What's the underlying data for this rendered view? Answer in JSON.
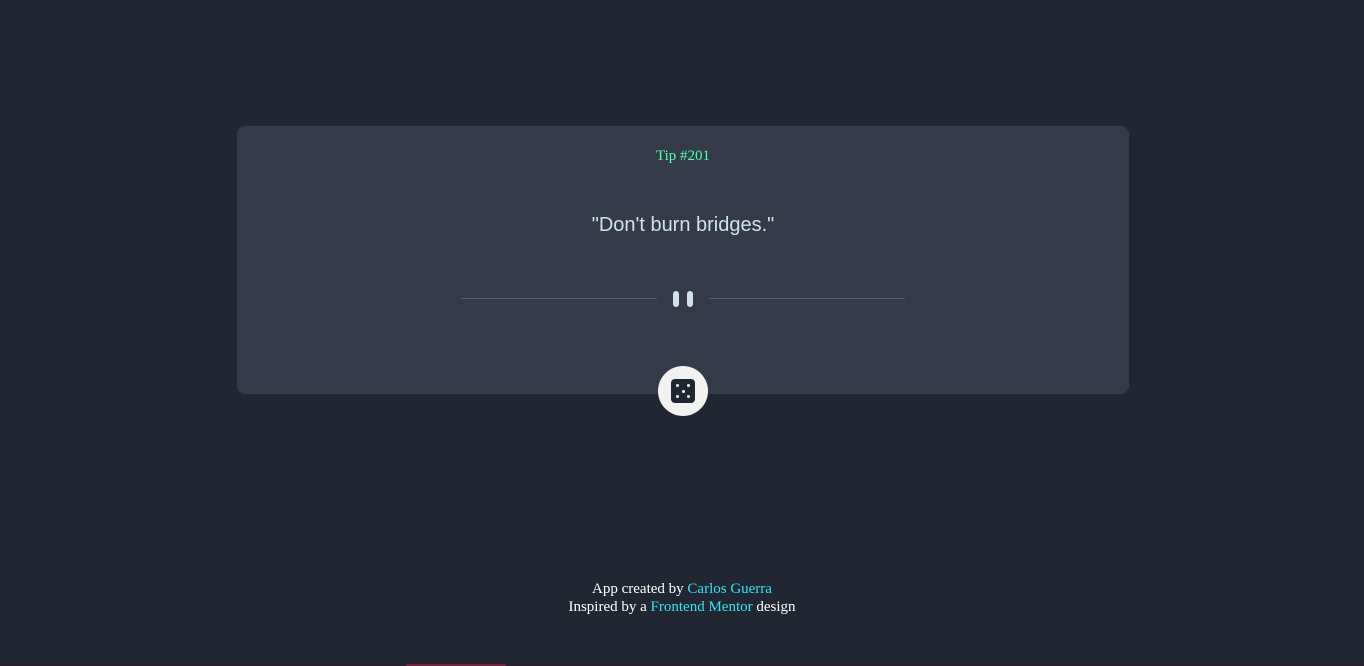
{
  "card": {
    "tip_label": "Tip #201",
    "quote": "\"Don't burn bridges.\""
  },
  "divider": {
    "icon": "pause-icon"
  },
  "dice_button": {
    "icon": "dice-icon"
  },
  "footer": {
    "line1_prefix": "App created by ",
    "author_link": "Carlos Guerra",
    "line2_prefix": "Inspired by a ",
    "mentor_link": "Frontend Mentor",
    "line2_suffix": " design"
  },
  "colors": {
    "background": "#202632",
    "card": "#343a4a",
    "tip_accent": "#52ffa8",
    "quote_text": "#cee3e9",
    "link": "#33e3f4"
  }
}
